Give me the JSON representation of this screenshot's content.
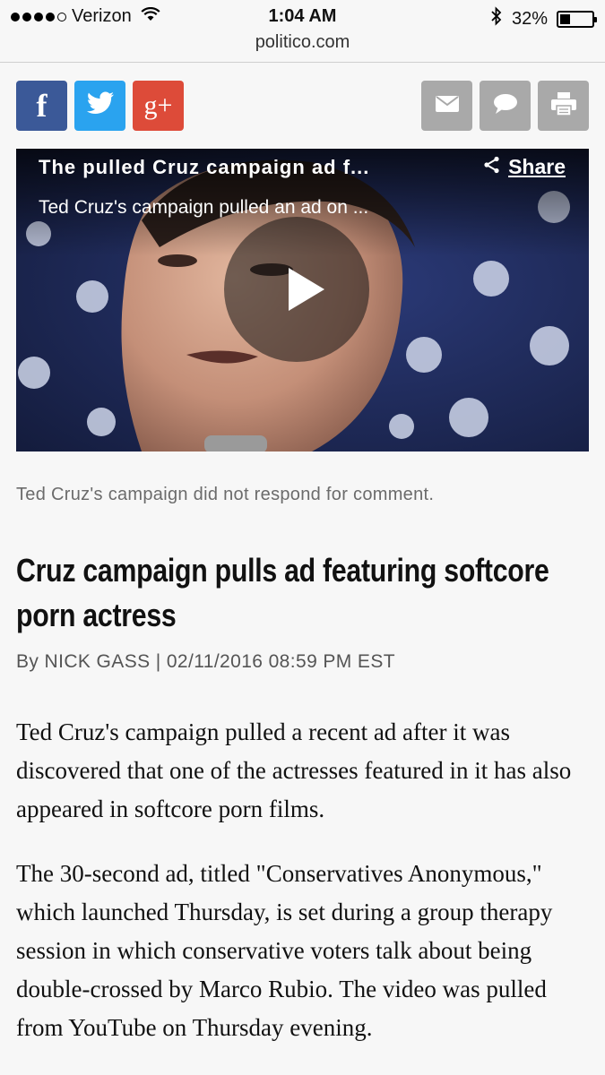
{
  "status": {
    "carrier": "Verizon",
    "time": "1:04 AM",
    "battery": "32%",
    "battery_level": 0.32
  },
  "browser": {
    "url": "politico.com"
  },
  "share_buttons": {
    "facebook": "f",
    "twitter_icon": "twitter-bird-icon",
    "googleplus": "g+",
    "mail_icon": "mail-icon",
    "comment_icon": "comment-icon",
    "print_icon": "print-icon"
  },
  "video": {
    "title": "The pulled Cruz campaign ad f...",
    "subtitle": "Ted Cruz's campaign pulled an ad on ...",
    "share_label": "Share"
  },
  "article": {
    "caption": "Ted Cruz's campaign did not respond for comment.",
    "headline": "Cruz campaign pulls ad featuring softcore porn actress",
    "byline": "By NICK GASS | 02/11/2016 08:59 PM EST",
    "paragraphs": [
      "Ted Cruz's campaign pulled a recent ad after it was discovered that one of the actresses featured in it has also appeared in softcore porn films.",
      "The 30-second ad, titled \"Conservatives Anonymous,\" which launched Thursday, is set during a group therapy session in which conservative voters talk about being double-crossed by Marco Rubio. The video was pulled from YouTube on Thursday evening."
    ]
  },
  "colors": {
    "facebook": "#3b5998",
    "twitter": "#2aa3ef",
    "googleplus": "#dd4b39",
    "utility_button": "#a9a9a9"
  }
}
